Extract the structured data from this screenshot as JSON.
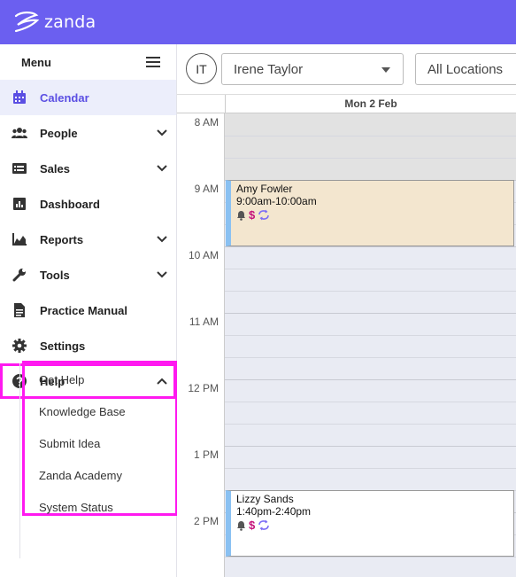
{
  "app": {
    "logo_text": "zanda",
    "brand_color": "#6b5ff0",
    "highlight_color": "#ff19f0"
  },
  "sidebar": {
    "title": "Menu",
    "items": [
      {
        "label": "Calendar",
        "icon": "calendar-icon",
        "active": true,
        "has_chevron": false
      },
      {
        "label": "People",
        "icon": "people-icon",
        "active": false,
        "has_chevron": true
      },
      {
        "label": "Sales",
        "icon": "sales-icon",
        "active": false,
        "has_chevron": true
      },
      {
        "label": "Dashboard",
        "icon": "dashboard-icon",
        "active": false,
        "has_chevron": false
      },
      {
        "label": "Reports",
        "icon": "reports-icon",
        "active": false,
        "has_chevron": true
      },
      {
        "label": "Tools",
        "icon": "wrench-icon",
        "active": false,
        "has_chevron": true
      },
      {
        "label": "Practice Manual",
        "icon": "document-icon",
        "active": false,
        "has_chevron": false
      },
      {
        "label": "Settings",
        "icon": "gear-icon",
        "active": false,
        "has_chevron": false
      },
      {
        "label": "Help",
        "icon": "question-icon",
        "active": false,
        "has_chevron": true,
        "expanded": true
      }
    ],
    "help_submenu": [
      "Get Help",
      "Knowledge Base",
      "Submit Idea",
      "Zanda Academy",
      "System Status"
    ]
  },
  "filters": {
    "staff_initials": "IT",
    "staff_name": "Irene Taylor",
    "location": "All Locations"
  },
  "calendar": {
    "day_label": "Mon 2 Feb",
    "hours": [
      "8 AM",
      "9 AM",
      "10 AM",
      "11 AM",
      "12 PM",
      "1 PM",
      "2 PM"
    ],
    "appointments": [
      {
        "client": "Amy Fowler",
        "time": "9:00am-10:00am"
      },
      {
        "client": "Lizzy Sands",
        "time": "1:40pm-2:40pm"
      }
    ]
  }
}
